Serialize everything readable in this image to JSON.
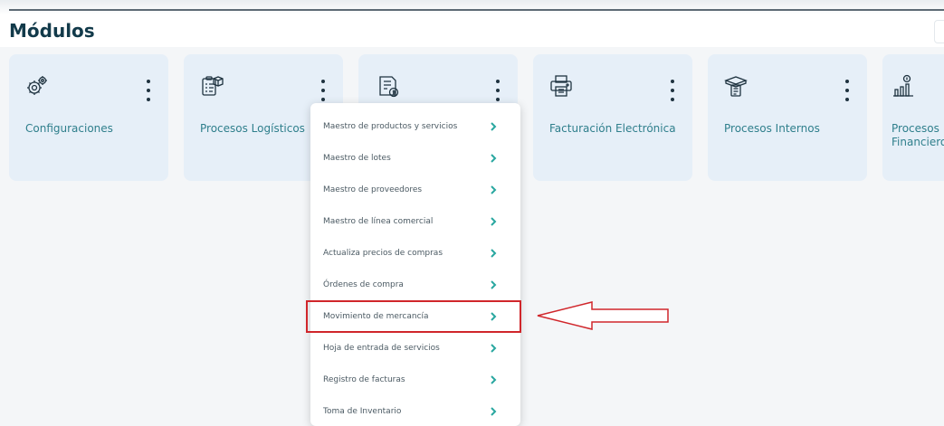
{
  "page": {
    "title": "Módulos"
  },
  "colors": {
    "card_bg": "#e6eff8",
    "card_label": "#2f7f8c",
    "chevron": "#29a7a0",
    "highlight": "#d0262b"
  },
  "modules": [
    {
      "label": "Configuraciones",
      "icon": "gears-icon"
    },
    {
      "label": "Procesos Logísticos",
      "icon": "clipboard-box-icon"
    },
    {
      "label": "",
      "icon": "document-dollar-icon"
    },
    {
      "label": "Facturación Electrónica",
      "icon": "printer-icon"
    },
    {
      "label": "Procesos Internos",
      "icon": "box-clipboard-icon"
    },
    {
      "label": "Procesos Financieros",
      "icon": "chart-dollar-icon"
    }
  ],
  "dropdown": {
    "items": [
      {
        "label": "Maestro de productos y servicios"
      },
      {
        "label": "Maestro de lotes"
      },
      {
        "label": "Maestro de proveedores"
      },
      {
        "label": "Maestro de línea comercial"
      },
      {
        "label": "Actualiza precios de compras"
      },
      {
        "label": "Órdenes de compra"
      },
      {
        "label": "Movimiento de mercancía",
        "highlighted": true
      },
      {
        "label": "Hoja de entrada de servicios"
      },
      {
        "label": "Registro de facturas"
      },
      {
        "label": "Toma de Inventario"
      }
    ],
    "chevron_icon": "chevron-right-icon"
  },
  "annotation": {
    "arrow_icon": "left-arrow-icon",
    "box": "highlight-box"
  }
}
